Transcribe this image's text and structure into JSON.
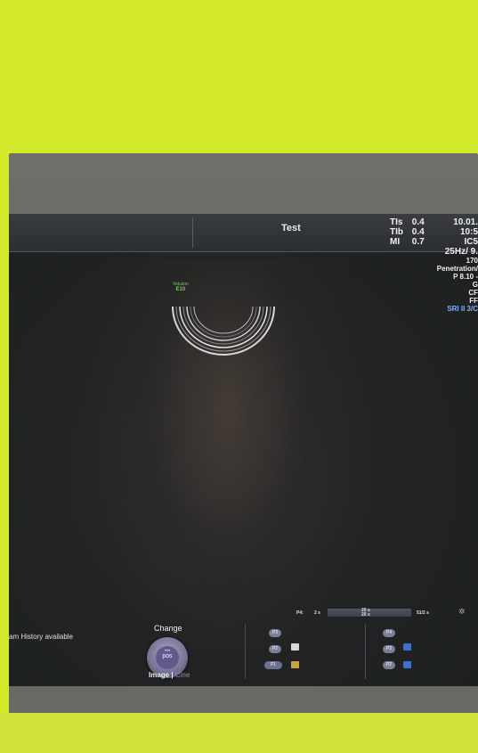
{
  "header": {
    "title": "Test",
    "left_params": [
      {
        "label": "TIs",
        "value": "0.4"
      },
      {
        "label": "TIb",
        "value": "0.4"
      },
      {
        "label": "MI",
        "value": "0.7"
      }
    ],
    "right_params": [
      "10.01.",
      "10:5",
      "IC5",
      "25Hz/ 9.",
      "170",
      "Penetration/",
      "P 8.10 -",
      "G",
      "CF",
      "FF",
      "SRI II 3/C"
    ]
  },
  "probe": {
    "line1": "Voluson",
    "line2": "E10"
  },
  "status": {
    "history_text": "am History available"
  },
  "knob": {
    "top_label": "Change",
    "center_label": "pos",
    "dots": "•••",
    "image_label": "Image",
    "cine_label": "Cine"
  },
  "cine": {
    "label": "P4:",
    "start": "2 s",
    "mid_top": "20 s",
    "mid_bottom": "20 s",
    "end": "51/2 s"
  },
  "buttons": {
    "p3": "P3",
    "p2": "P2",
    "p1": "P1",
    "p4": "P4"
  },
  "colors": {
    "background_wall": "#d3ea2a",
    "screen": "#222424",
    "probe_text": "#6dd35a",
    "sri_text": "#7fb2ff",
    "knob": "#7a7696"
  },
  "icons": [
    "gear-icon",
    "save-icon",
    "print-icon"
  ]
}
